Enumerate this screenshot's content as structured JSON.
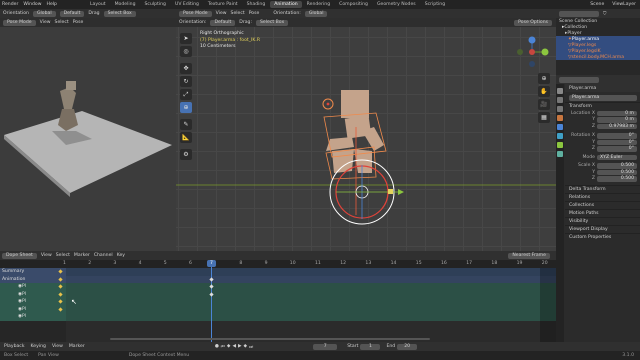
{
  "menu": {
    "items": [
      "Render",
      "Window",
      "Help"
    ],
    "workspaces": [
      "Layout",
      "Modeling",
      "Sculpting",
      "UV Editing",
      "Texture Paint",
      "Shading",
      "Animation",
      "Rendering",
      "Compositing",
      "Geometry Nodes",
      "Scripting"
    ],
    "active_workspace": "Animation",
    "scene": "Scene",
    "view_layer": "ViewLayer"
  },
  "left_header": {
    "orientation": "Orientation",
    "global": "Global",
    "default": "Default",
    "drag": "Drag",
    "select": "Select Box"
  },
  "left_header2": {
    "pose_mode": "Pose Mode",
    "view": "View",
    "select": "Select",
    "pose": "Pose"
  },
  "main_header": {
    "orientation_label": "Orientation:",
    "orientation": "Global",
    "default": "Default",
    "drag": "Drag:",
    "select_box": "Select Box",
    "pose_options": "Pose Options"
  },
  "viewport_info": {
    "line1": "Right Orthographic",
    "line2": "(7) Player.arma : foot_IK.R",
    "line3": "10 Centimeters"
  },
  "outliner": {
    "title": "Scene Collection",
    "items": [
      {
        "label": "Collection",
        "selected": false,
        "indent": 1
      },
      {
        "label": "Player",
        "selected": false,
        "indent": 2
      },
      {
        "label": "Player.arma",
        "selected": true,
        "indent": 3
      },
      {
        "label": "Player.legs",
        "selected": true,
        "indent": 3
      },
      {
        "label": "Player.legsIK",
        "selected": true,
        "indent": 3
      },
      {
        "label": "stencil.body.MCH.arma",
        "selected": true,
        "indent": 3
      }
    ]
  },
  "properties": {
    "object": "Player.arma",
    "bone": "Player.arma",
    "transform_title": "Transform",
    "location": [
      {
        "label": "Location X",
        "value": "0 m"
      },
      {
        "label": "Y",
        "value": "0 m"
      },
      {
        "label": "Z",
        "value": "0.97983 m"
      }
    ],
    "rotation": [
      {
        "label": "Rotation X",
        "value": "0°"
      },
      {
        "label": "Y",
        "value": "0°"
      },
      {
        "label": "Z",
        "value": "0°"
      }
    ],
    "mode_label": "Mode",
    "mode_value": "XYZ Euler",
    "scale": [
      {
        "label": "Scale X",
        "value": "0.500"
      },
      {
        "label": "Y",
        "value": "0.500"
      },
      {
        "label": "Z",
        "value": "0.500"
      }
    ],
    "sections": [
      "Delta Transform",
      "Relations",
      "Collections",
      "Motion Paths",
      "Visibility",
      "Viewport Display",
      "Custom Properties"
    ]
  },
  "dope_sheet": {
    "header": {
      "mode": "Dope Sheet",
      "view": "View",
      "select": "Select",
      "marker": "Marker",
      "channel": "Channel",
      "key": "Key",
      "snap": "Nearest Frame"
    },
    "frames": [
      "1",
      "2",
      "3",
      "4",
      "5",
      "6",
      "7",
      "8",
      "9",
      "10",
      "11",
      "12",
      "13",
      "14",
      "15",
      "16",
      "17",
      "18",
      "19",
      "20"
    ],
    "current_frame": "7",
    "channels": [
      "Summary",
      "Animation",
      "Pl",
      "Pl",
      "Pl",
      "Pl",
      "Pl"
    ],
    "row_colors": [
      "#2e3f57",
      "#3a4b6a",
      "#2f5a4e",
      "#2f5a4e",
      "#2f5a4e",
      "#2f5a4e",
      "#2f5a4e"
    ]
  },
  "playback": {
    "playback": "Playback",
    "keying": "Keying",
    "view": "View",
    "marker": "Marker",
    "current_frame": "7",
    "start_label": "Start",
    "start": "1",
    "end_label": "End",
    "end": "20"
  },
  "status": {
    "items": [
      "Box Select",
      "Pan View",
      "Dope Sheet Context Menu"
    ],
    "version": "3.1.0"
  },
  "colors": {
    "accent": "#4772b3",
    "bone_orange": "#f08a4b",
    "bone_red": "#e0433a",
    "keyframe": "#e8c14a"
  }
}
